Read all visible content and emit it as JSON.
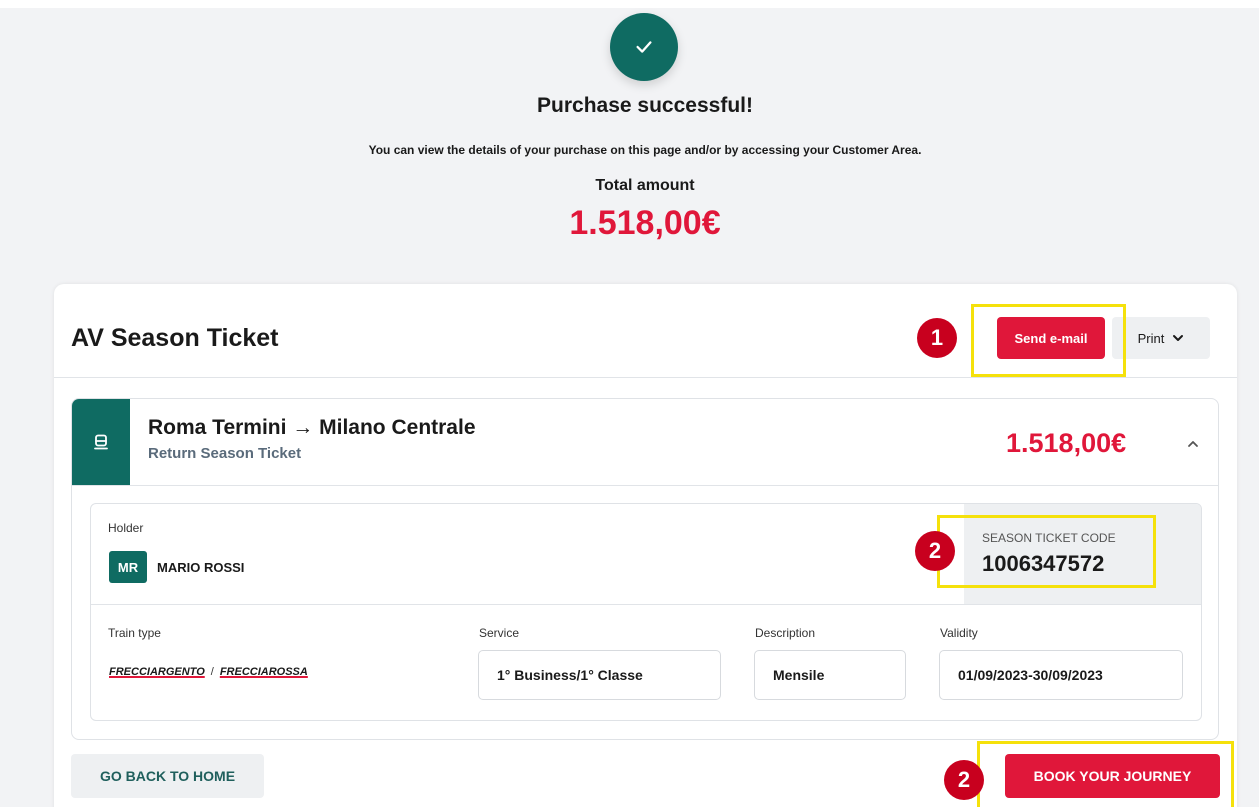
{
  "header": {
    "title": "Purchase successful!",
    "subtitle": "You can view the details of your purchase on this page and/or by accessing your Customer Area.",
    "total_label": "Total amount",
    "total_amount": "1.518,00€"
  },
  "ticket_card": {
    "title": "AV Season Ticket",
    "send_email_label": "Send e-mail",
    "print_label": "Print"
  },
  "journey": {
    "route": "Roma Termini → Milano Centrale",
    "type": "Return Season Ticket",
    "price": "1.518,00€"
  },
  "holder": {
    "label": "Holder",
    "initials": "MR",
    "name": "MARIO ROSSI"
  },
  "season_ticket": {
    "code_label": "SEASON TICKET CODE",
    "code": "1006347572"
  },
  "fields": {
    "train_type_label": "Train type",
    "train_type_1": "FRECCIARGENTO",
    "train_type_sep": "/",
    "train_type_2": "FRECCIAROSSA",
    "service_label": "Service",
    "service_value": "1° Business/1° Classe",
    "description_label": "Description",
    "description_value": "Mensile",
    "validity_label": "Validity",
    "validity_value": "01/09/2023-30/09/2023"
  },
  "footer": {
    "home_label": "GO BACK TO HOME",
    "book_label": "BOOK YOUR JOURNEY"
  },
  "annotations": {
    "marker_1": "1",
    "marker_2a": "2",
    "marker_2b": "2"
  },
  "colors": {
    "accent_red": "#e0173a",
    "brand_green": "#0f6b62",
    "highlight_yellow": "#f5e10b",
    "marker_red": "#c8001e"
  },
  "icons": [
    "check-icon",
    "chevron-down-icon",
    "train-icon",
    "chevron-up-icon"
  ]
}
